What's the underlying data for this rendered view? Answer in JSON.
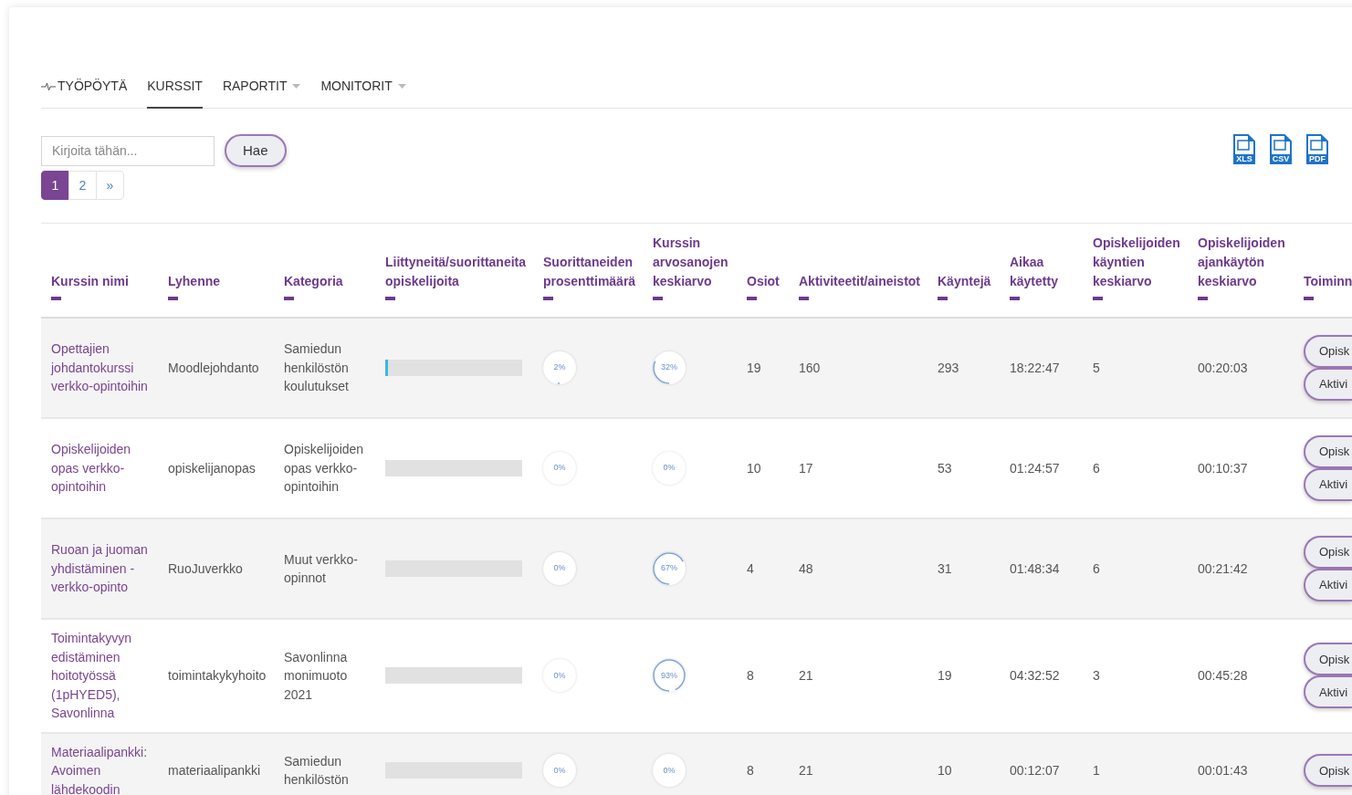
{
  "tabs": [
    {
      "label": "TYÖPÖYTÄ",
      "selected": false,
      "icon": true,
      "dropdown": false
    },
    {
      "label": "KURSSIT",
      "selected": true,
      "icon": false,
      "dropdown": false
    },
    {
      "label": "RAPORTIT",
      "selected": false,
      "icon": false,
      "dropdown": true
    },
    {
      "label": "MONITORIT",
      "selected": false,
      "icon": false,
      "dropdown": true
    }
  ],
  "search": {
    "placeholder": "Kirjoita tähän...",
    "button": "Hae"
  },
  "pagination": [
    {
      "label": "1",
      "selected": true
    },
    {
      "label": "2",
      "selected": false
    },
    {
      "label": "»",
      "selected": false
    }
  ],
  "exports": [
    "XLS",
    "CSV",
    "PDF"
  ],
  "table": {
    "columns": [
      [
        "Kurssin nimi"
      ],
      [
        "Lyhenne"
      ],
      [
        "Kategoria"
      ],
      [
        "Liittyneitä/suorittaneita",
        "opiskelijoita"
      ],
      [
        "Suorittaneiden",
        "prosenttimäärä"
      ],
      [
        "Kurssin",
        "arvosanojen",
        "keskiarvo"
      ],
      [
        "Osiot"
      ],
      [
        "Aktiviteetit/aineistot"
      ],
      [
        "Käyntejä"
      ],
      [
        "Aikaa",
        "käytetty"
      ],
      [
        "Opiskelijoiden",
        "käyntien",
        "keskiarvo"
      ],
      [
        "Opiskelijoiden",
        "ajankäytön",
        "keskiarvo"
      ],
      [
        "Toiminn"
      ]
    ],
    "rows": [
      {
        "name": "Opettajien johdantokurssi verkko-opintoihin",
        "short": "Moodlejohdanto",
        "category": "Samiedun henkilöstön koulutukset",
        "enrolled": {
          "level": 0.02
        },
        "completion": "2%",
        "grade": "32%",
        "sections": "19",
        "activities": "160",
        "visits": "293",
        "time": "18:22:47",
        "avg_visits": "5",
        "avg_time": "00:20:03",
        "actions": [
          "Opisk",
          "Aktivi"
        ]
      },
      {
        "name": "Opiskelijoiden opas verkko-opintoihin",
        "short": "opiskelijanopas",
        "category": "Opiskelijoiden opas verkko-opintoihin",
        "enrolled": {
          "level": 0
        },
        "completion": "0%",
        "grade": "0%",
        "sections": "10",
        "activities": "17",
        "visits": "53",
        "time": "01:24:57",
        "avg_visits": "6",
        "avg_time": "00:10:37",
        "actions": [
          "Opisk",
          "Aktivi"
        ]
      },
      {
        "name": "Ruoan ja juoman yhdistäminen - verkko-opinto",
        "short": "RuoJuverkko",
        "category": "Muut verkko-opinnot",
        "enrolled": {
          "level": 0
        },
        "completion": "0%",
        "grade": "67%",
        "sections": "4",
        "activities": "48",
        "visits": "31",
        "time": "01:48:34",
        "avg_visits": "6",
        "avg_time": "00:21:42",
        "actions": [
          "Opisk",
          "Aktivi"
        ]
      },
      {
        "name": "Toimintakyvyn edistäminen hoitotyössä (1pHYED5), Savonlinna",
        "short": "toimintakykyhoito",
        "category": "Savonlinna monimuoto 2021",
        "enrolled": {
          "level": 0
        },
        "completion": "0%",
        "grade": "93%",
        "sections": "8",
        "activities": "21",
        "visits": "19",
        "time": "04:32:52",
        "avg_visits": "3",
        "avg_time": "00:45:28",
        "actions": [
          "Opisk",
          "Aktivi"
        ]
      },
      {
        "name": "Materiaalipankki: Avoimen lähdekoodin",
        "short": "materiaalipankki",
        "category": "Samiedun henkilöstön",
        "enrolled": {
          "level": 0
        },
        "completion": "0%",
        "grade": "0%",
        "sections": "8",
        "activities": "21",
        "visits": "10",
        "time": "00:12:07",
        "avg_visits": "1",
        "avg_time": "00:01:43",
        "actions": [
          "Opisk"
        ]
      }
    ]
  }
}
